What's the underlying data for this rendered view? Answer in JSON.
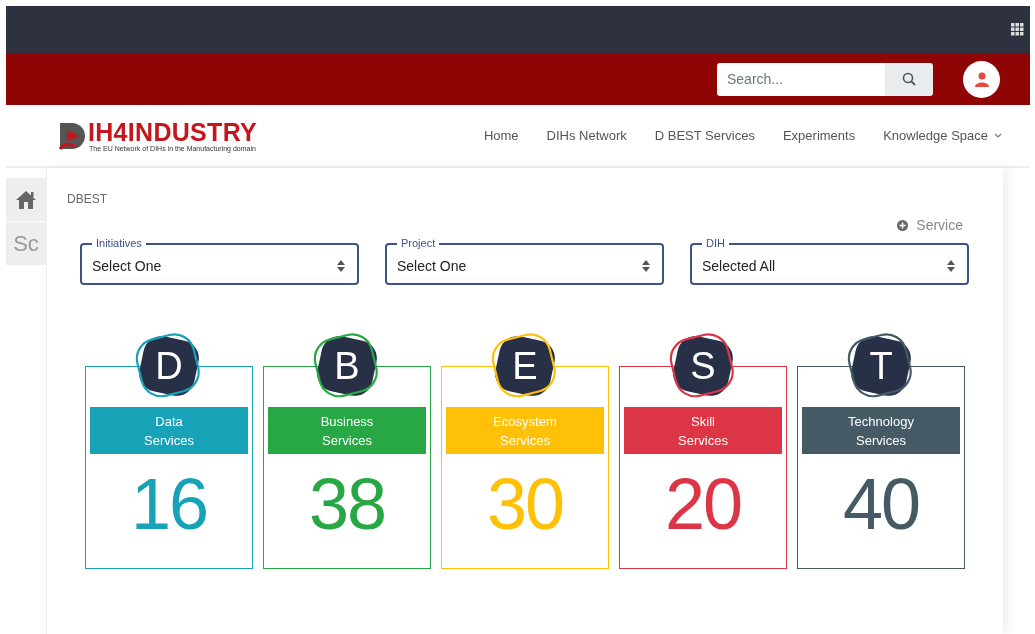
{
  "header": {
    "search": {
      "placeholder": "Search..."
    }
  },
  "navbar": {
    "logo": {
      "title": "IH4INDUSTRY",
      "subtitle": "The EU Network of DIHs in the Manufacturing domain"
    },
    "items": [
      {
        "label": "Home",
        "has_menu": false
      },
      {
        "label": "DIHs Network",
        "has_menu": false
      },
      {
        "label": "D BEST Services",
        "has_menu": false
      },
      {
        "label": "Experiments",
        "has_menu": false
      },
      {
        "label": "Knowledge Space",
        "has_menu": true
      }
    ]
  },
  "side_tabs": [
    {
      "kind": "icon"
    },
    {
      "kind": "text",
      "label": "Sc"
    }
  ],
  "breadcrumb": "DBEST",
  "add_button": "Service",
  "filters": [
    {
      "label": "Initiatives",
      "value": "Select One"
    },
    {
      "label": "Project",
      "value": "Select One"
    },
    {
      "label": "DIH",
      "value": "Selected All"
    }
  ],
  "services": [
    {
      "letter": "D",
      "title": [
        "Data",
        "Services"
      ],
      "count": "16",
      "color": "#17a2b8"
    },
    {
      "letter": "B",
      "title": [
        "Business",
        "Services"
      ],
      "count": "38",
      "color": "#28a745"
    },
    {
      "letter": "E",
      "title": [
        "Ecosystem",
        "Services"
      ],
      "count": "30",
      "color": "#ffc107"
    },
    {
      "letter": "S",
      "title": [
        "Skill",
        "Services"
      ],
      "count": "20",
      "color": "#dc3545"
    },
    {
      "letter": "T",
      "title": [
        "Technology",
        "Services"
      ],
      "count": "40",
      "color": "#455a64"
    }
  ]
}
